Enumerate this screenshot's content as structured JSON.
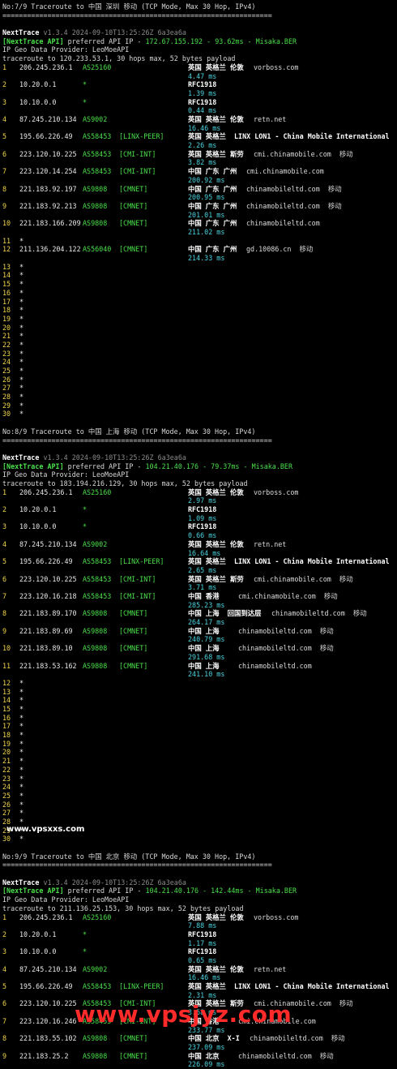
{
  "watermarks": {
    "top": "www.vpsxxs.com",
    "bottom": "www.vpsjyz.com"
  },
  "sections": [
    {
      "header": "No:7/9 Traceroute to 中国 深圳 移动 (TCP Mode, Max 30 Hop, IPv4)",
      "separator": "==================================================================",
      "tool": "NextTrace",
      "version": "v1.3.4 2024-09-10T13:25:26Z 6a3ea6a",
      "api_label": "[NextTrace API]",
      "api_text": " preferred API IP - ",
      "api_ip": "172.67.155.192 - 93.62ms - Misaka.BER",
      "geo_provider": "IP Geo Data Provider: LeoMoeAPI",
      "trace_line": "traceroute to 120.233.53.1, 30 hops max, 52 bytes payload",
      "hops": [
        {
          "n": "1",
          "ip": "206.245.236.1",
          "asn": "AS25160",
          "tag": "",
          "geo": "英国 英格兰 伦敦",
          "host": "vorboss.com",
          "rtt": "4.47 ms"
        },
        {
          "n": "2",
          "ip": "10.20.0.1",
          "asn": "*",
          "tag": "",
          "geo": "RFC1918",
          "host": "",
          "rtt": "1.39 ms"
        },
        {
          "n": "3",
          "ip": "10.10.0.0",
          "asn": "*",
          "tag": "",
          "geo": "RFC1918",
          "host": "",
          "rtt": "0.44 ms"
        },
        {
          "n": "4",
          "ip": "87.245.210.134",
          "asn": "AS9002",
          "tag": "",
          "geo": "英国 英格兰 伦敦",
          "host": "retn.net",
          "rtt": "16.46 ms"
        },
        {
          "n": "5",
          "ip": "195.66.226.49",
          "asn": "AS58453",
          "tag": "[LINX-PEER]",
          "geo": "英国 英格兰  LINX LON1 - China Mobile International",
          "host": "",
          "rtt": "2.26 ms"
        },
        {
          "n": "6",
          "ip": "223.120.10.225",
          "asn": "AS58453",
          "tag": "[CMI-INT]",
          "geo": "英国 英格兰 斯劳",
          "host": "cmi.chinamobile.com  移动",
          "rtt": "3.82 ms"
        },
        {
          "n": "7",
          "ip": "223.120.14.254",
          "asn": "AS58453",
          "tag": "[CMI-INT]",
          "geo": "中国 广东 广州",
          "host": "cmi.chinamobile.com",
          "rtt": "200.92 ms"
        },
        {
          "n": "8",
          "ip": "221.183.92.197",
          "asn": "AS9808",
          "tag": "[CMNET]",
          "geo": "中国 广东 广州",
          "host": "chinamobileltd.com  移动",
          "rtt": "200.95 ms"
        },
        {
          "n": "9",
          "ip": "221.183.92.213",
          "asn": "AS9808",
          "tag": "[CMNET]",
          "geo": "中国 广东 广州",
          "host": "chinamobileltd.com  移动",
          "rtt": "201.01 ms"
        },
        {
          "n": "10",
          "ip": "221.183.166.209",
          "asn": "AS9808",
          "tag": "[CMNET]",
          "geo": "中国 广东 广州",
          "host": "chinamobileltd.com",
          "rtt": "211.02 ms"
        },
        {
          "n": "11",
          "ip": "*",
          "asn": "",
          "tag": "",
          "geo": "",
          "host": "",
          "rtt": ""
        },
        {
          "n": "12",
          "ip": "211.136.204.122",
          "asn": "AS56040",
          "tag": "[CMNET]",
          "geo": "中国 广东 广州",
          "host": "gd.10086.cn  移动",
          "rtt": "214.33 ms"
        }
      ],
      "empty_hops": [
        "13",
        "14",
        "15",
        "16",
        "17",
        "18",
        "19",
        "20",
        "21",
        "22",
        "23",
        "24",
        "25",
        "26",
        "27",
        "28",
        "29",
        "30"
      ]
    },
    {
      "header": "No:8/9 Traceroute to 中国 上海 移动 (TCP Mode, Max 30 Hop, IPv4)",
      "separator": "==================================================================",
      "tool": "NextTrace",
      "version": "v1.3.4 2024-09-10T13:25:26Z 6a3ea6a",
      "api_label": "[NextTrace API]",
      "api_text": " preferred API IP - ",
      "api_ip": "104.21.40.176 - 79.37ms - Misaka.BER",
      "geo_provider": "IP Geo Data Provider: LeoMoeAPI",
      "trace_line": "traceroute to 183.194.216.129, 30 hops max, 52 bytes payload",
      "hops": [
        {
          "n": "1",
          "ip": "206.245.236.1",
          "asn": "AS25160",
          "tag": "",
          "geo": "英国 英格兰 伦敦",
          "host": "vorboss.com",
          "rtt": "2.97 ms"
        },
        {
          "n": "2",
          "ip": "10.20.0.1",
          "asn": "*",
          "tag": "",
          "geo": "RFC1918",
          "host": "",
          "rtt": "1.09 ms"
        },
        {
          "n": "3",
          "ip": "10.10.0.0",
          "asn": "*",
          "tag": "",
          "geo": "RFC1918",
          "host": "",
          "rtt": "0.66 ms"
        },
        {
          "n": "4",
          "ip": "87.245.210.134",
          "asn": "AS9002",
          "tag": "",
          "geo": "英国 英格兰 伦敦",
          "host": "retn.net",
          "rtt": "16.64 ms"
        },
        {
          "n": "5",
          "ip": "195.66.226.49",
          "asn": "AS58453",
          "tag": "[LINX-PEER]",
          "geo": "英国 英格兰  LINX LON1 - China Mobile International",
          "host": "",
          "rtt": "2.65 ms"
        },
        {
          "n": "6",
          "ip": "223.120.10.225",
          "asn": "AS58453",
          "tag": "[CMI-INT]",
          "geo": "英国 英格兰 斯劳",
          "host": "cmi.chinamobile.com  移动",
          "rtt": "3.71 ms"
        },
        {
          "n": "7",
          "ip": "223.120.16.218",
          "asn": "AS58453",
          "tag": "[CMI-INT]",
          "geo": "中国 香港",
          "host": "cmi.chinamobile.com  移动",
          "rtt": "285.23 ms"
        },
        {
          "n": "8",
          "ip": "221.183.89.170",
          "asn": "AS9808",
          "tag": "[CMNET]",
          "geo": "中国 上海  回国到达层",
          "host": "chinamobileltd.com  移动",
          "rtt": "264.17 ms"
        },
        {
          "n": "9",
          "ip": "221.183.89.69",
          "asn": "AS9808",
          "tag": "[CMNET]",
          "geo": "中国 上海",
          "host": "chinamobileltd.com  移动",
          "rtt": "240.79 ms"
        },
        {
          "n": "10",
          "ip": "221.183.89.10",
          "asn": "AS9808",
          "tag": "[CMNET]",
          "geo": "中国 上海",
          "host": "chinamobileltd.com  移动",
          "rtt": "291.68 ms"
        },
        {
          "n": "11",
          "ip": "221.183.53.162",
          "asn": "AS9808",
          "tag": "[CMNET]",
          "geo": "中国 上海",
          "host": "chinamobileltd.com",
          "rtt": "241.10 ms"
        }
      ],
      "empty_hops": [
        "12",
        "13",
        "14",
        "15",
        "16",
        "17",
        "18",
        "19",
        "20",
        "21",
        "22",
        "23",
        "24",
        "25",
        "26",
        "27",
        "28",
        "29",
        "30"
      ]
    },
    {
      "header": "No:9/9 Traceroute to 中国 北京 移动 (TCP Mode, Max 30 Hop, IPv4)",
      "separator": "==================================================================",
      "tool": "NextTrace",
      "version": "v1.3.4 2024-09-10T13:25:26Z 6a3ea6a",
      "api_label": "[NextTrace API]",
      "api_text": " preferred API IP - ",
      "api_ip": "104.21.40.176 - 142.44ms - Misaka.BER",
      "geo_provider": "IP Geo Data Provider: LeoMoeAPI",
      "trace_line": "traceroute to 211.136.25.153, 30 hops max, 52 bytes payload",
      "hops": [
        {
          "n": "1",
          "ip": "206.245.236.1",
          "asn": "AS25160",
          "tag": "",
          "geo": "英国 英格兰 伦敦",
          "host": "vorboss.com",
          "rtt": "7.88 ms"
        },
        {
          "n": "2",
          "ip": "10.20.0.1",
          "asn": "*",
          "tag": "",
          "geo": "RFC1918",
          "host": "",
          "rtt": "1.17 ms"
        },
        {
          "n": "3",
          "ip": "10.10.0.0",
          "asn": "*",
          "tag": "",
          "geo": "RFC1918",
          "host": "",
          "rtt": "0.65 ms"
        },
        {
          "n": "4",
          "ip": "87.245.210.134",
          "asn": "AS9002",
          "tag": "",
          "geo": "英国 英格兰 伦敦",
          "host": "retn.net",
          "rtt": "16.46 ms"
        },
        {
          "n": "5",
          "ip": "195.66.226.49",
          "asn": "AS58453",
          "tag": "[LINX-PEER]",
          "geo": "英国 英格兰  LINX LON1 - China Mobile International",
          "host": "",
          "rtt": "2.31 ms"
        },
        {
          "n": "6",
          "ip": "223.120.10.225",
          "asn": "AS58453",
          "tag": "[CMI-INT]",
          "geo": "英国 英格兰 斯劳",
          "host": "cmi.chinamobile.com  移动",
          "rtt": "3.58 ms"
        },
        {
          "n": "7",
          "ip": "223.120.16.246",
          "asn": "AS58453",
          "tag": "[CMI-INT]",
          "geo": "中国 香港",
          "host": "cmi.chinamobile.com",
          "rtt": "233.77 ms"
        },
        {
          "n": "8",
          "ip": "221.183.55.102",
          "asn": "AS9808",
          "tag": "[CMNET]",
          "geo": "中国 北京  X-I",
          "host": "chinamobileltd.com  移动",
          "rtt": "237.09 ms"
        },
        {
          "n": "9",
          "ip": "221.183.25.2",
          "asn": "AS9808",
          "tag": "[CMNET]",
          "geo": "中国 北京",
          "host": "chinamobileltd.com  移动",
          "rtt": "226.09 ms"
        }
      ],
      "empty_hops": []
    }
  ]
}
